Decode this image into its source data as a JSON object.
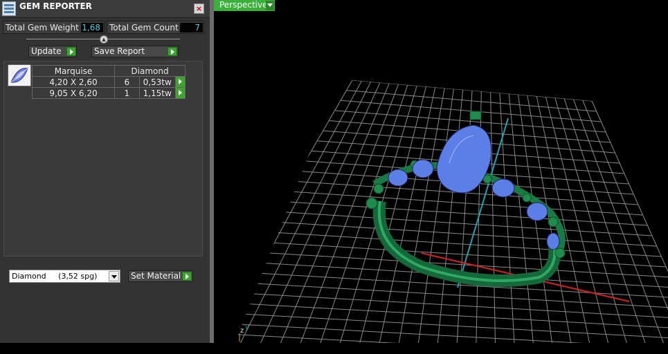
{
  "window": {
    "title": "GEM REPORTER",
    "close_label": "×"
  },
  "stats": {
    "weight_label": "Total Gem Weight",
    "weight_value": "1,68",
    "count_label": "Total Gem Count",
    "count_value": "7"
  },
  "buttons": {
    "update": "Update",
    "save_report": "Save Report",
    "set_material": "Set Material"
  },
  "gem_table": {
    "headers": [
      "Marquise",
      "Diamond"
    ],
    "rows": [
      {
        "size": "4,20 X 2,60",
        "count": "6",
        "weight": "0,53tw"
      },
      {
        "size": "9,05 X 6,20",
        "count": "1",
        "weight": "1,15tw"
      }
    ]
  },
  "material": {
    "selected": "Diamond     (3,52 spg)"
  },
  "viewport": {
    "label": "Perspective"
  },
  "icons": [
    "app-icon",
    "close-icon",
    "collapse-icon",
    "arrow-icon",
    "marquise-gem-icon",
    "dropdown-arrow-icon"
  ],
  "colors": {
    "accent": "#3da52f",
    "value_text": "#41d6e6",
    "gem_blue": "#5b7fe6",
    "metal_green": "#1a6b3a"
  }
}
